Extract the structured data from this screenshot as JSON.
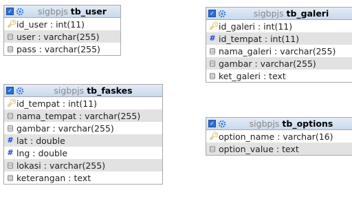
{
  "tables": [
    {
      "db": "sigbpjs",
      "name": "tb_user",
      "columns": [
        {
          "icon": "primary-key-icon",
          "label": "id_user : int(11)"
        },
        {
          "icon": "text-column-icon",
          "label": "user : varchar(255)"
        },
        {
          "icon": "text-column-icon",
          "label": "pass : varchar(255)"
        }
      ]
    },
    {
      "db": "sigbpjs",
      "name": "tb_galeri",
      "columns": [
        {
          "icon": "primary-key-icon",
          "label": "id_galeri : int(11)"
        },
        {
          "icon": "numeric-column-icon",
          "label": "id_tempat : int(11)"
        },
        {
          "icon": "text-column-icon",
          "label": "nama_galeri : varchar(255)"
        },
        {
          "icon": "text-column-icon",
          "label": "gambar : varchar(255)"
        },
        {
          "icon": "text-column-icon",
          "label": "ket_galeri : text"
        }
      ]
    },
    {
      "db": "sigbpjs",
      "name": "tb_faskes",
      "columns": [
        {
          "icon": "primary-key-icon",
          "label": "id_tempat : int(11)"
        },
        {
          "icon": "text-column-icon",
          "label": "nama_tempat : varchar(255)"
        },
        {
          "icon": "text-column-icon",
          "label": "gambar : varchar(255)"
        },
        {
          "icon": "numeric-column-icon",
          "label": "lat : double"
        },
        {
          "icon": "numeric-column-icon",
          "label": "lng : double"
        },
        {
          "icon": "text-column-icon",
          "label": "lokasi : varchar(255)"
        },
        {
          "icon": "text-column-icon",
          "label": "keterangan : text"
        }
      ]
    },
    {
      "db": "sigbpjs",
      "name": "tb_options",
      "columns": [
        {
          "icon": "primary-key-icon",
          "label": "option_name : varchar(16)"
        },
        {
          "icon": "text-column-icon",
          "label": "option_value : text"
        }
      ]
    }
  ]
}
